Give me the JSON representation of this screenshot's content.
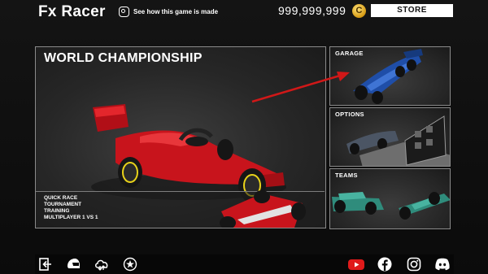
{
  "header": {
    "app_title": "Fx Racer",
    "how_made_label": "See how this game is made",
    "coins": "999,999,999",
    "coin_symbol": "C",
    "store_label": "STORE"
  },
  "main": {
    "title": "WORLD CHAMPIONSHIP",
    "menu_items": [
      "QUICK RACE",
      "TOURNAMENT",
      "TRAINING",
      "MULTIPLAYER 1 VS 1"
    ]
  },
  "side_panels": {
    "garage_label": "GARAGE",
    "options_label": "OPTIONS",
    "teams_label": "TEAMS"
  },
  "bottom_icons": {
    "left": [
      "exit-icon",
      "helmet-icon",
      "cloud-sync-icon",
      "achievements-icon"
    ],
    "right": [
      "youtube-icon",
      "facebook-icon",
      "instagram-icon",
      "discord-icon"
    ]
  },
  "colors": {
    "car_red": "#c8141c",
    "car_blue": "#1f4ea8",
    "teams_teal": "#2f8c7c",
    "arrow_red": "#d01818",
    "youtube_red": "#e01a1a"
  }
}
